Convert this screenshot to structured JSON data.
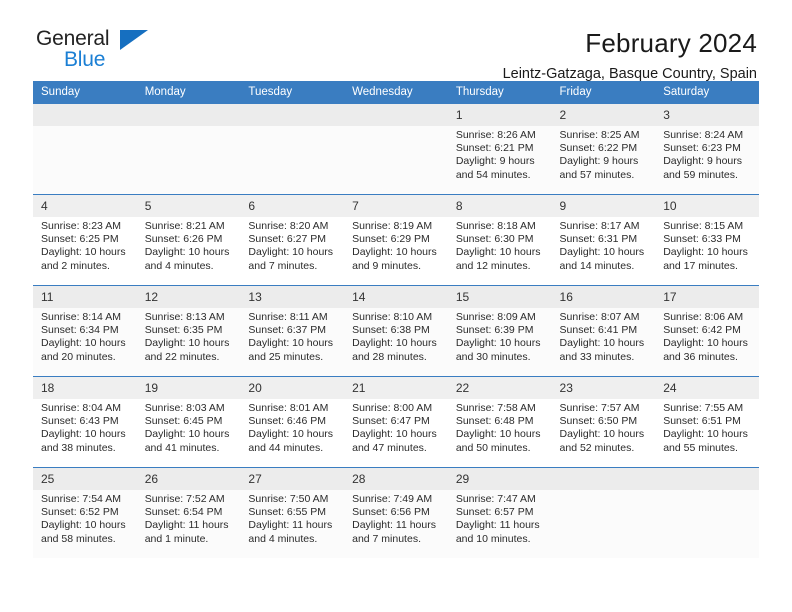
{
  "brand": {
    "name_part1": "General",
    "name_part2": "Blue",
    "accent_color": "#1b7fd4",
    "triangle_icon": "triangle-icon"
  },
  "header": {
    "title": "February 2024",
    "subtitle": "Leintz-Gatzaga, Basque Country, Spain"
  },
  "calendar": {
    "header_bg": "#3a7dc1",
    "weekdays": [
      "Sunday",
      "Monday",
      "Tuesday",
      "Wednesday",
      "Thursday",
      "Friday",
      "Saturday"
    ],
    "weeks": [
      [
        {
          "day": "",
          "lines": []
        },
        {
          "day": "",
          "lines": []
        },
        {
          "day": "",
          "lines": []
        },
        {
          "day": "",
          "lines": []
        },
        {
          "day": "1",
          "lines": [
            "Sunrise: 8:26 AM",
            "Sunset: 6:21 PM",
            "Daylight: 9 hours",
            "and 54 minutes."
          ]
        },
        {
          "day": "2",
          "lines": [
            "Sunrise: 8:25 AM",
            "Sunset: 6:22 PM",
            "Daylight: 9 hours",
            "and 57 minutes."
          ]
        },
        {
          "day": "3",
          "lines": [
            "Sunrise: 8:24 AM",
            "Sunset: 6:23 PM",
            "Daylight: 9 hours",
            "and 59 minutes."
          ]
        }
      ],
      [
        {
          "day": "4",
          "lines": [
            "Sunrise: 8:23 AM",
            "Sunset: 6:25 PM",
            "Daylight: 10 hours",
            "and 2 minutes."
          ]
        },
        {
          "day": "5",
          "lines": [
            "Sunrise: 8:21 AM",
            "Sunset: 6:26 PM",
            "Daylight: 10 hours",
            "and 4 minutes."
          ]
        },
        {
          "day": "6",
          "lines": [
            "Sunrise: 8:20 AM",
            "Sunset: 6:27 PM",
            "Daylight: 10 hours",
            "and 7 minutes."
          ]
        },
        {
          "day": "7",
          "lines": [
            "Sunrise: 8:19 AM",
            "Sunset: 6:29 PM",
            "Daylight: 10 hours",
            "and 9 minutes."
          ]
        },
        {
          "day": "8",
          "lines": [
            "Sunrise: 8:18 AM",
            "Sunset: 6:30 PM",
            "Daylight: 10 hours",
            "and 12 minutes."
          ]
        },
        {
          "day": "9",
          "lines": [
            "Sunrise: 8:17 AM",
            "Sunset: 6:31 PM",
            "Daylight: 10 hours",
            "and 14 minutes."
          ]
        },
        {
          "day": "10",
          "lines": [
            "Sunrise: 8:15 AM",
            "Sunset: 6:33 PM",
            "Daylight: 10 hours",
            "and 17 minutes."
          ]
        }
      ],
      [
        {
          "day": "11",
          "lines": [
            "Sunrise: 8:14 AM",
            "Sunset: 6:34 PM",
            "Daylight: 10 hours",
            "and 20 minutes."
          ]
        },
        {
          "day": "12",
          "lines": [
            "Sunrise: 8:13 AM",
            "Sunset: 6:35 PM",
            "Daylight: 10 hours",
            "and 22 minutes."
          ]
        },
        {
          "day": "13",
          "lines": [
            "Sunrise: 8:11 AM",
            "Sunset: 6:37 PM",
            "Daylight: 10 hours",
            "and 25 minutes."
          ]
        },
        {
          "day": "14",
          "lines": [
            "Sunrise: 8:10 AM",
            "Sunset: 6:38 PM",
            "Daylight: 10 hours",
            "and 28 minutes."
          ]
        },
        {
          "day": "15",
          "lines": [
            "Sunrise: 8:09 AM",
            "Sunset: 6:39 PM",
            "Daylight: 10 hours",
            "and 30 minutes."
          ]
        },
        {
          "day": "16",
          "lines": [
            "Sunrise: 8:07 AM",
            "Sunset: 6:41 PM",
            "Daylight: 10 hours",
            "and 33 minutes."
          ]
        },
        {
          "day": "17",
          "lines": [
            "Sunrise: 8:06 AM",
            "Sunset: 6:42 PM",
            "Daylight: 10 hours",
            "and 36 minutes."
          ]
        }
      ],
      [
        {
          "day": "18",
          "lines": [
            "Sunrise: 8:04 AM",
            "Sunset: 6:43 PM",
            "Daylight: 10 hours",
            "and 38 minutes."
          ]
        },
        {
          "day": "19",
          "lines": [
            "Sunrise: 8:03 AM",
            "Sunset: 6:45 PM",
            "Daylight: 10 hours",
            "and 41 minutes."
          ]
        },
        {
          "day": "20",
          "lines": [
            "Sunrise: 8:01 AM",
            "Sunset: 6:46 PM",
            "Daylight: 10 hours",
            "and 44 minutes."
          ]
        },
        {
          "day": "21",
          "lines": [
            "Sunrise: 8:00 AM",
            "Sunset: 6:47 PM",
            "Daylight: 10 hours",
            "and 47 minutes."
          ]
        },
        {
          "day": "22",
          "lines": [
            "Sunrise: 7:58 AM",
            "Sunset: 6:48 PM",
            "Daylight: 10 hours",
            "and 50 minutes."
          ]
        },
        {
          "day": "23",
          "lines": [
            "Sunrise: 7:57 AM",
            "Sunset: 6:50 PM",
            "Daylight: 10 hours",
            "and 52 minutes."
          ]
        },
        {
          "day": "24",
          "lines": [
            "Sunrise: 7:55 AM",
            "Sunset: 6:51 PM",
            "Daylight: 10 hours",
            "and 55 minutes."
          ]
        }
      ],
      [
        {
          "day": "25",
          "lines": [
            "Sunrise: 7:54 AM",
            "Sunset: 6:52 PM",
            "Daylight: 10 hours",
            "and 58 minutes."
          ]
        },
        {
          "day": "26",
          "lines": [
            "Sunrise: 7:52 AM",
            "Sunset: 6:54 PM",
            "Daylight: 11 hours",
            "and 1 minute."
          ]
        },
        {
          "day": "27",
          "lines": [
            "Sunrise: 7:50 AM",
            "Sunset: 6:55 PM",
            "Daylight: 11 hours",
            "and 4 minutes."
          ]
        },
        {
          "day": "28",
          "lines": [
            "Sunrise: 7:49 AM",
            "Sunset: 6:56 PM",
            "Daylight: 11 hours",
            "and 7 minutes."
          ]
        },
        {
          "day": "29",
          "lines": [
            "Sunrise: 7:47 AM",
            "Sunset: 6:57 PM",
            "Daylight: 11 hours",
            "and 10 minutes."
          ]
        },
        {
          "day": "",
          "lines": []
        },
        {
          "day": "",
          "lines": []
        }
      ]
    ]
  }
}
